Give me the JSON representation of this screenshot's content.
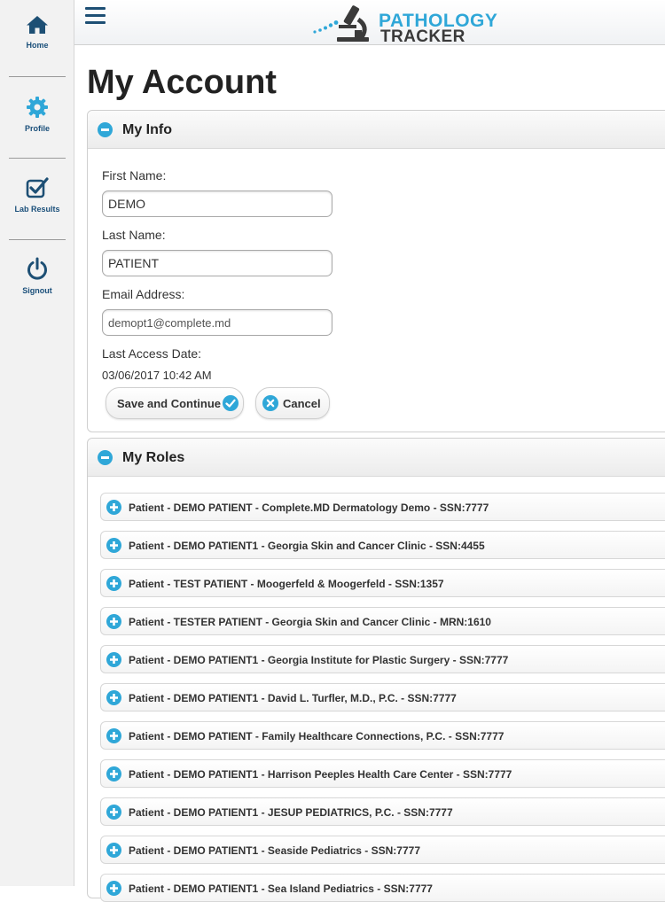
{
  "app": {
    "logo_line1": "PATHOLOGY",
    "logo_line2": "TRACKER",
    "accent_color": "#2fa7d8"
  },
  "sidebar": {
    "items": [
      {
        "label": "Home",
        "icon": "home-icon"
      },
      {
        "label": "Profile",
        "icon": "gear-icon"
      },
      {
        "label": "Lab Results",
        "icon": "checkbox-icon"
      },
      {
        "label": "Signout",
        "icon": "power-icon"
      }
    ]
  },
  "page": {
    "title": "My Account"
  },
  "my_info": {
    "header": "My Info",
    "first_name_label": "First Name:",
    "first_name_value": "DEMO",
    "last_name_label": "Last Name:",
    "last_name_value": "PATIENT",
    "email_label": "Email Address:",
    "email_value": "demopt1@complete.md",
    "last_access_label": "Last Access Date:",
    "last_access_value": "03/06/2017 10:42 AM",
    "save_label": "Save and Continue",
    "cancel_label": "Cancel"
  },
  "my_roles": {
    "header": "My Roles",
    "items": [
      "Patient - DEMO PATIENT - Complete.MD Dermatology Demo - SSN:7777",
      "Patient - DEMO PATIENT1 - Georgia Skin and Cancer Clinic - SSN:4455",
      "Patient - TEST PATIENT - Moogerfeld & Moogerfeld - SSN:1357",
      "Patient - TESTER PATIENT - Georgia Skin and Cancer Clinic - MRN:1610",
      "Patient - DEMO PATIENT1 - Georgia Institute for Plastic Surgery - SSN:7777",
      "Patient - DEMO PATIENT1 - David L. Turfler, M.D., P.C. - SSN:7777",
      "Patient - DEMO PATIENT - Family Healthcare Connections, P.C. - SSN:7777",
      "Patient - DEMO PATIENT1 - Harrison Peeples Health Care Center - SSN:7777",
      "Patient - DEMO PATIENT1 - JESUP PEDIATRICS, P.C. - SSN:7777",
      "Patient - DEMO PATIENT1 - Seaside Pediatrics - SSN:7777",
      "Patient - DEMO PATIENT1 - Sea Island Pediatrics - SSN:7777"
    ]
  }
}
